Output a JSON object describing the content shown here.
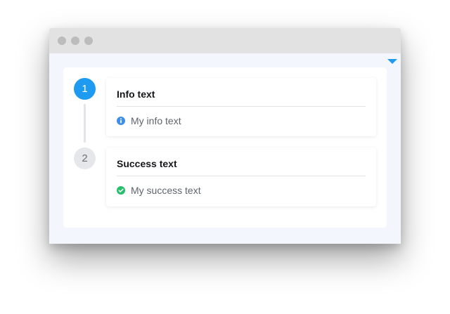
{
  "steps": [
    {
      "number": "1",
      "state": "active",
      "title": "Info text",
      "message": "My info text",
      "icon": "info-icon",
      "icon_color": "#3d8ef0"
    },
    {
      "number": "2",
      "state": "idle",
      "title": "Success text",
      "message": "My success text",
      "icon": "check-circle-icon",
      "icon_color": "#27c06a"
    }
  ],
  "colors": {
    "accent": "#1e9bf0",
    "info": "#3d8ef0",
    "success": "#27c06a"
  }
}
